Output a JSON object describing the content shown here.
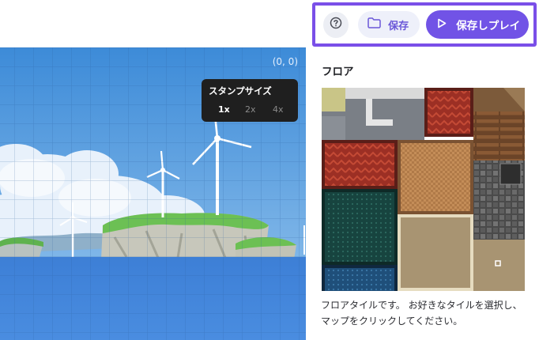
{
  "toolbar": {
    "help_icon": "help-circle-icon",
    "save_label": "保存",
    "save_icon": "folder-icon",
    "save_play_label": "保存しプレイ",
    "save_play_icon": "play-icon",
    "accent_color": "#7153e6",
    "highlight_border_color": "#7a4fe8"
  },
  "map": {
    "coordinates": "(0, 0)",
    "stamp_size": {
      "title": "スタンプサイズ",
      "options": [
        "1x",
        "2x",
        "4x"
      ],
      "selected": "1x"
    }
  },
  "panel": {
    "title": "フロア",
    "description": "フロアタイルです。 お好きなタイルを選択し、マップをクリックしてください。"
  }
}
